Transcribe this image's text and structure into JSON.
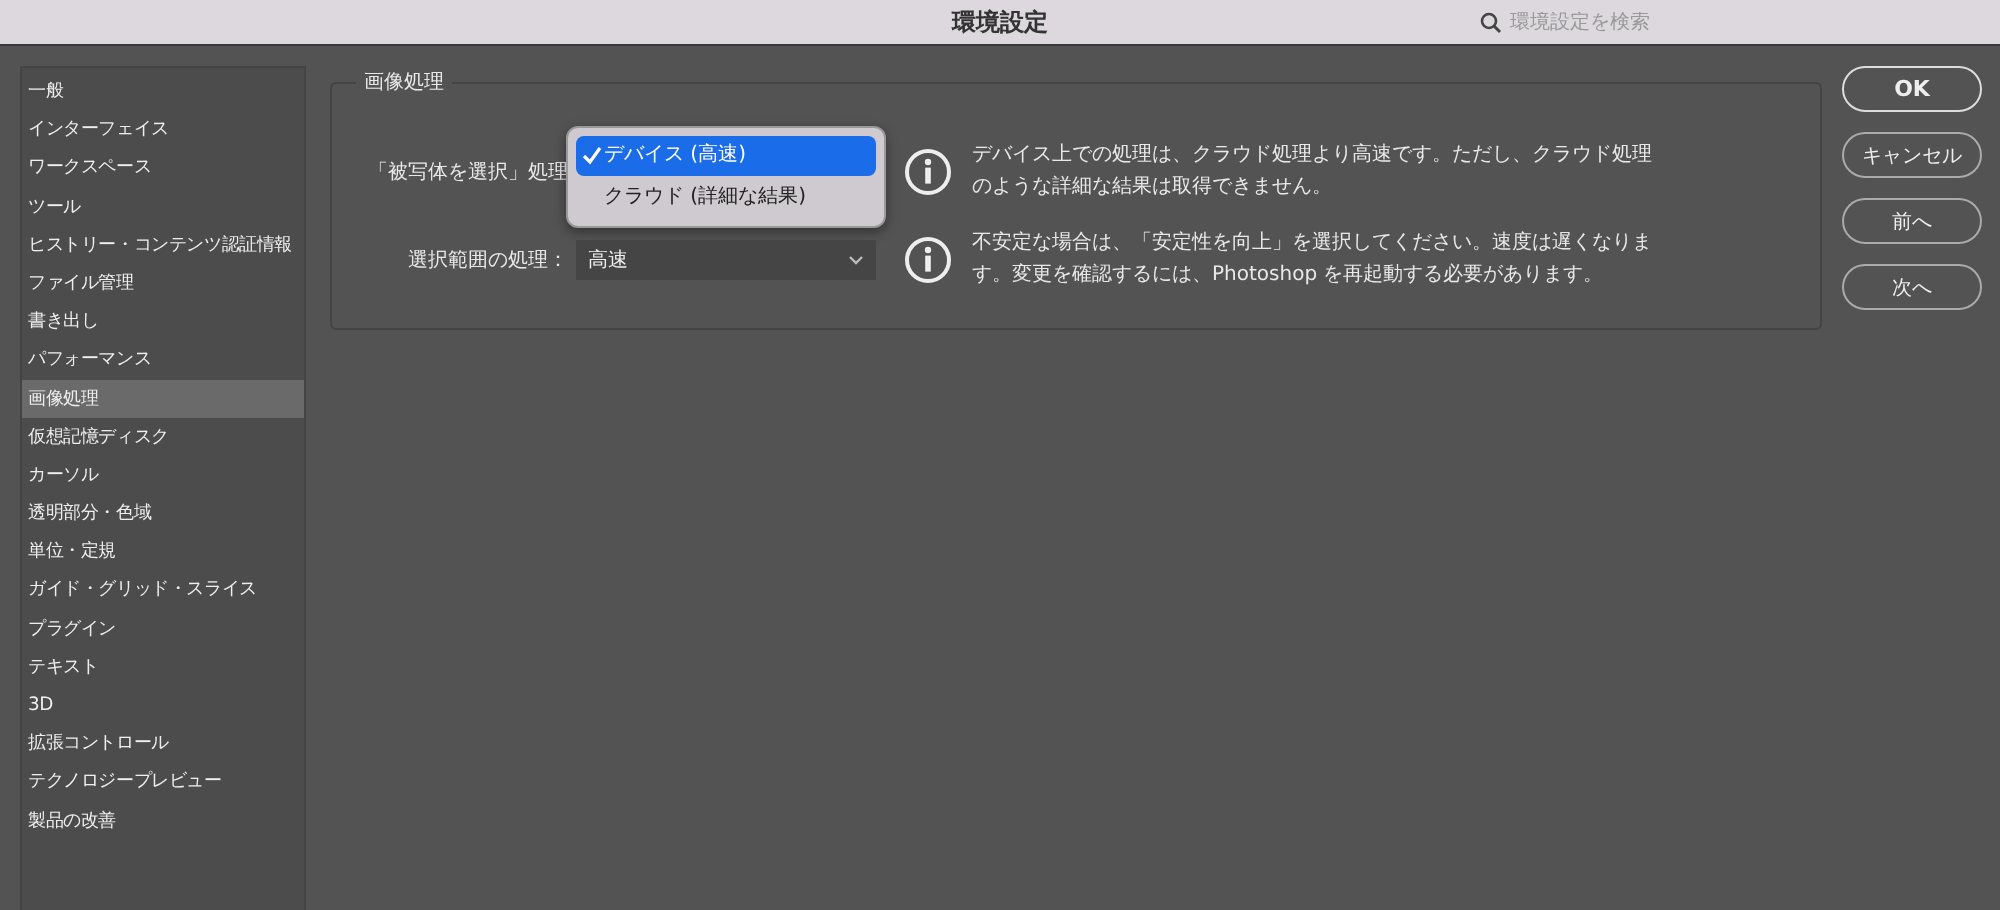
{
  "window": {
    "title": "環境設定"
  },
  "search": {
    "placeholder": "環境設定を検索"
  },
  "sidebar": {
    "items": [
      {
        "label": "一般",
        "selected": false
      },
      {
        "label": "インターフェイス",
        "selected": false
      },
      {
        "label": "ワークスペース",
        "selected": false
      },
      {
        "label": "ツール",
        "selected": false
      },
      {
        "label": "ヒストリー・コンテンツ認証情報",
        "selected": false
      },
      {
        "label": "ファイル管理",
        "selected": false
      },
      {
        "label": "書き出し",
        "selected": false
      },
      {
        "label": "パフォーマンス",
        "selected": false
      },
      {
        "label": "画像処理",
        "selected": true
      },
      {
        "label": "仮想記憶ディスク",
        "selected": false
      },
      {
        "label": "カーソル",
        "selected": false
      },
      {
        "label": "透明部分・色域",
        "selected": false
      },
      {
        "label": "単位・定規",
        "selected": false
      },
      {
        "label": "ガイド・グリッド・スライス",
        "selected": false
      },
      {
        "label": "プラグイン",
        "selected": false
      },
      {
        "label": "テキスト",
        "selected": false
      },
      {
        "label": "3D",
        "selected": false
      },
      {
        "label": "拡張コントロール",
        "selected": false
      },
      {
        "label": "テクノロジープレビュー",
        "selected": false
      },
      {
        "label": "製品の改善",
        "selected": false
      }
    ]
  },
  "group": {
    "title": "画像処理",
    "settings": [
      {
        "label": "「被写体を選択」処理",
        "open": true,
        "options": [
          {
            "label": "デバイス (高速)",
            "selected": true
          },
          {
            "label": "クラウド (詳細な結果)",
            "selected": false
          }
        ],
        "description": "デバイス上での処理は、クラウド処理より高速です。ただし、クラウド処理のような詳細な結果は取得できません。"
      },
      {
        "label": "選択範囲の処理：",
        "open": false,
        "value": "高速",
        "description": "不安定な場合は、「安定性を向上」を選択してください。速度は遅くなります。変更を確認するには、Photoshop を再起動する必要があります。"
      }
    ]
  },
  "buttons": [
    {
      "label": "OK",
      "kind": "default"
    },
    {
      "label": "キャンセル",
      "kind": "normal"
    },
    {
      "label": "前へ",
      "kind": "normal"
    },
    {
      "label": "次へ",
      "kind": "normal"
    }
  ]
}
